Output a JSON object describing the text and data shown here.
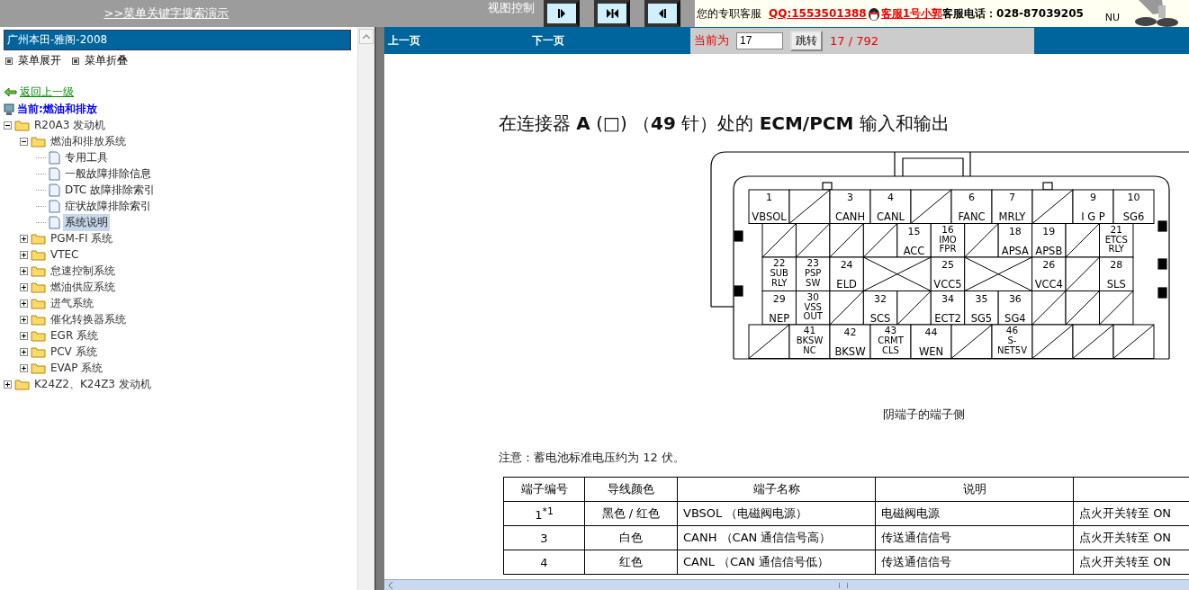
{
  "top_bar": {
    "search_demo_link": ">>菜单关键字搜索演示",
    "view_control_label": "视图控制",
    "view_buttons": [
      {
        "kind": "right"
      },
      {
        "kind": "center"
      },
      {
        "kind": "left"
      }
    ],
    "contact": {
      "label": "您的专职客服",
      "qq": "QQ:1553501388",
      "agent": "客服1号小郭",
      "phone": "客服电话：028-87039205",
      "badge": "NU"
    }
  },
  "sidebar": {
    "title": "广州本田-雅阁-2008",
    "menu_actions": [
      "菜单展开",
      "菜单折叠"
    ],
    "back_link": "返回上一级",
    "current": "当前:燃油和排放",
    "tree": [
      {
        "label": "R20A3 发动机",
        "kind": "folder",
        "expanded": true,
        "selected": false,
        "children": [
          {
            "label": "燃油和排放系统",
            "kind": "folder",
            "expanded": true,
            "selected": false,
            "children": [
              {
                "label": "专用工具",
                "kind": "page",
                "selected": false
              },
              {
                "label": "一般故障排除信息",
                "kind": "page",
                "selected": false
              },
              {
                "label": "DTC 故障排除索引",
                "kind": "page",
                "selected": false
              },
              {
                "label": "症状故障排除索引",
                "kind": "page",
                "selected": false
              },
              {
                "label": "系统说明",
                "kind": "page",
                "selected": true
              }
            ]
          },
          {
            "label": "PGM-FI 系统",
            "kind": "folder",
            "expanded": false,
            "selected": false
          },
          {
            "label": "VTEC",
            "kind": "folder",
            "expanded": false,
            "selected": false
          },
          {
            "label": "怠速控制系统",
            "kind": "folder",
            "expanded": false,
            "selected": false
          },
          {
            "label": "燃油供应系统",
            "kind": "folder",
            "expanded": false,
            "selected": false
          },
          {
            "label": "进气系统",
            "kind": "folder",
            "expanded": false,
            "selected": false
          },
          {
            "label": "催化转换器系统",
            "kind": "folder",
            "expanded": false,
            "selected": false
          },
          {
            "label": "EGR 系统",
            "kind": "folder",
            "expanded": false,
            "selected": false
          },
          {
            "label": "PCV 系统",
            "kind": "folder",
            "expanded": false,
            "selected": false
          },
          {
            "label": "EVAP 系统",
            "kind": "folder",
            "expanded": false,
            "selected": false
          }
        ]
      },
      {
        "label": "K24Z2、K24Z3 发动机",
        "kind": "folder",
        "expanded": false,
        "selected": false
      }
    ]
  },
  "pager": {
    "prev": "上一页",
    "next": "下一页",
    "current_label": "当前为",
    "page_value": "17",
    "jump_button": "跳转",
    "page_count": "17 / 792"
  },
  "document": {
    "heading": "在连接器 **A** (□) （**49** 针）处的 **ECM/PCM** 输入和输出",
    "connector": [
      [
        {
          "kind": "pin",
          "number": "1",
          "label": "VBSOL"
        },
        {
          "kind": "blank"
        },
        {
          "kind": "pin",
          "number": "3",
          "label": "CANH"
        },
        {
          "kind": "pin",
          "number": "4",
          "label": "CANL"
        },
        {
          "kind": "blank"
        },
        {
          "kind": "pin",
          "number": "6",
          "label": "FANC"
        },
        {
          "kind": "pin",
          "number": "7",
          "label": "MRLY"
        },
        {
          "kind": "blank"
        },
        {
          "kind": "pin",
          "number": "9",
          "label": "I G P"
        },
        {
          "kind": "pin",
          "number": "10",
          "label": "SG6"
        }
      ],
      [
        {
          "kind": "blank"
        },
        {
          "kind": "blank"
        },
        {
          "kind": "blank"
        },
        {
          "kind": "blank"
        },
        {
          "kind": "pin",
          "number": "15",
          "label": "ACC"
        },
        {
          "kind": "pin",
          "number": "16",
          "label": "IMO\nFPR"
        },
        {
          "kind": "blank"
        },
        {
          "kind": "pin",
          "number": "18",
          "label": "APSA"
        },
        {
          "kind": "pin",
          "number": "19",
          "label": "APSB"
        },
        {
          "kind": "blank"
        },
        {
          "kind": "pin",
          "number": "21",
          "label": "ETCS\nRLY"
        }
      ],
      [
        {
          "kind": "pin",
          "number": "22",
          "label": "SUB\nRLY"
        },
        {
          "kind": "pin",
          "number": "23",
          "label": "PSP\nSW"
        },
        {
          "kind": "pin",
          "number": "24",
          "label": "ELD"
        },
        {
          "kind": "cross"
        },
        {
          "kind": "pin",
          "number": "25",
          "label": "VCC5"
        },
        {
          "kind": "cross"
        },
        {
          "kind": "pin",
          "number": "26",
          "label": "VCC4"
        },
        {
          "kind": "blank"
        },
        {
          "kind": "pin",
          "number": "28",
          "label": "SLS"
        }
      ],
      [
        {
          "kind": "pin",
          "number": "29",
          "label": "NEP"
        },
        {
          "kind": "pin",
          "number": "30",
          "label": "VSS\nOUT"
        },
        {
          "kind": "blank"
        },
        {
          "kind": "pin",
          "number": "32",
          "label": "SCS"
        },
        {
          "kind": "blank"
        },
        {
          "kind": "pin",
          "number": "34",
          "label": "ECT2"
        },
        {
          "kind": "pin",
          "number": "35",
          "label": "SG5"
        },
        {
          "kind": "pin",
          "number": "36",
          "label": "SG4"
        },
        {
          "kind": "blank"
        },
        {
          "kind": "blank"
        },
        {
          "kind": "blank"
        }
      ],
      [
        {
          "kind": "blank"
        },
        {
          "kind": "pin",
          "number": "41",
          "label": "BKSW\nNC"
        },
        {
          "kind": "pin",
          "number": "42",
          "label": "BKSW"
        },
        {
          "kind": "pin",
          "number": "43",
          "label": "CRMT\nCLS"
        },
        {
          "kind": "pin",
          "number": "44",
          "label": "WEN"
        },
        {
          "kind": "blank"
        },
        {
          "kind": "pin",
          "number": "46",
          "label": "S-\nNET5V"
        },
        {
          "kind": "blank"
        },
        {
          "kind": "blank"
        },
        {
          "kind": "blank"
        }
      ]
    ],
    "caption": "阴端子的端子侧",
    "note": "注意：蓄电池标准电压约为 12 伏。",
    "table": {
      "columns": [
        "端子编号",
        "导线颜色",
        "端子名称",
        "说明"
      ],
      "rows": [
        [
          "1$^{*1}$",
          "黑色 / 红色",
          "VBSOL （电磁阀电源）",
          "电磁阀电源",
          "点火开关转至 ON"
        ],
        [
          "3",
          "白色",
          "CANH （CAN 通信信号高）",
          "传送通信信号",
          "点火开关转至 ON"
        ],
        [
          "4",
          "红色",
          "CANL （CAN 通信信号低）",
          "传送通信信号",
          "点火开关转至 ON"
        ]
      ]
    }
  }
}
